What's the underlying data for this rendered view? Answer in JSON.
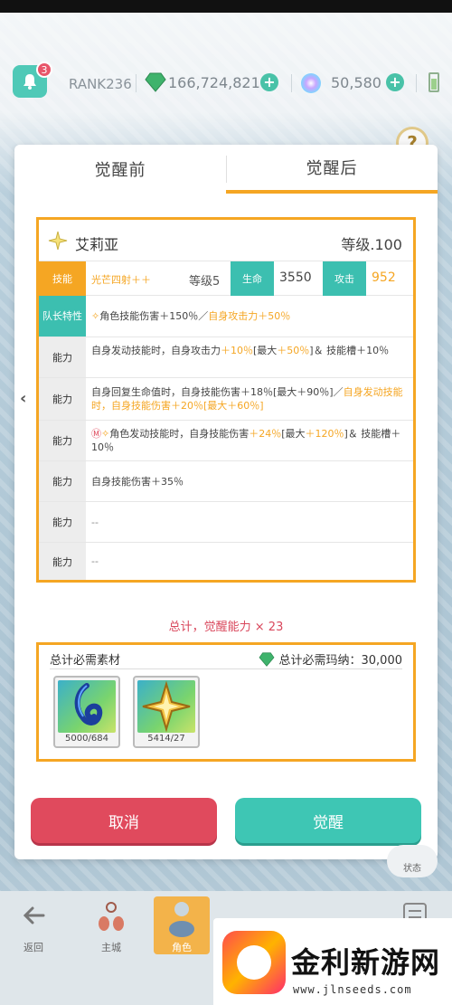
{
  "topbar": {
    "notification_count": "3",
    "rank": "RANK236",
    "gems": "166,724,821",
    "orbs": "50,580"
  },
  "tabs": [
    "觉醒前",
    "觉醒后"
  ],
  "character": {
    "name": "艾莉亚",
    "level": "等级.100",
    "skill_label": "技能",
    "skill_name": "光芒四射＋＋",
    "skill_level": "等级5",
    "hp_label": "生命",
    "hp": "3550",
    "atk_label": "攻击",
    "atk": "952"
  },
  "leader": {
    "label": "队长特性",
    "text_a": "角色技能伤害＋150％／",
    "text_b": "自身攻击力＋50％"
  },
  "abilities": [
    {
      "label": "能力",
      "a": "自身发动技能时，自身攻击力",
      "b": "＋10％",
      "c": "[最大",
      "d": "＋50％",
      "e": "]＆ 技能槽＋10％"
    },
    {
      "label": "能力",
      "a": "自身回复生命值时，自身技能伤害＋18％[最大＋90％]／",
      "b": "自身发动技能时，自身技能伤害＋20％[最大＋60％]"
    },
    {
      "label": "能力",
      "a": "角色发动技能时，自身技能伤害",
      "b": "＋24％",
      "c": "[最大",
      "d": "＋120％",
      "e": "]＆ 技能槽＋10％"
    },
    {
      "label": "能力",
      "a": "自身技能伤害＋35％"
    },
    {
      "label": "能力",
      "a": "--"
    },
    {
      "label": "能力",
      "a": "--"
    }
  ],
  "total": {
    "line": "总计，觉醒能力 × 23",
    "materials_title": "总计必需素材",
    "mana_cost": "总计必需玛纳：30,000",
    "items": [
      {
        "name": "blue-crystal",
        "count": "5000/684"
      },
      {
        "name": "gold-star",
        "count": "5414/27"
      }
    ]
  },
  "buttons": {
    "cancel": "取消",
    "awaken": "觉醒"
  },
  "status_chip": "状态",
  "nav": {
    "back": "返回",
    "main_city": "主城",
    "character": "角色"
  },
  "watermark": {
    "title": "金利新游网",
    "url": "www.jlnseeds.com"
  },
  "colors": {
    "accent": "#f5a623",
    "teal": "#3cbfb0",
    "red": "#e04a5d"
  }
}
